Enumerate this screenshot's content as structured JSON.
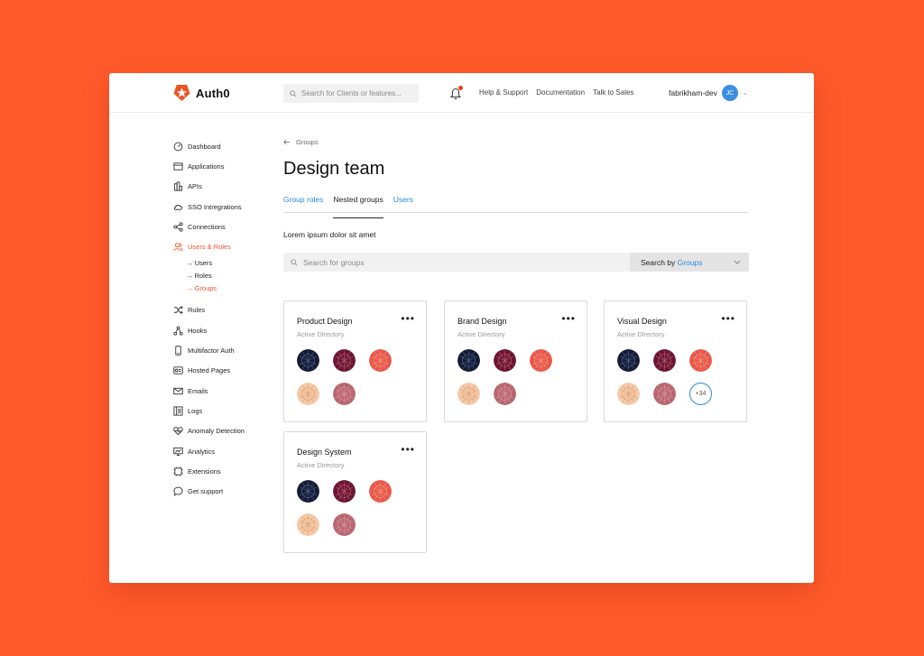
{
  "topbar": {
    "logo_text": "Auth0",
    "search_placeholder": "Search for Clients or features...",
    "links": [
      "Help & Support",
      "Documentation",
      "Talk to Sales"
    ],
    "tenant": "fabrikham-dev",
    "avatar_initials": "JC"
  },
  "sidebar": {
    "items": [
      {
        "label": "Dashboard",
        "icon": "dashboard-icon"
      },
      {
        "label": "Applications",
        "icon": "applications-icon"
      },
      {
        "label": "APIs",
        "icon": "apis-icon"
      },
      {
        "label": "SSO Intregrations",
        "icon": "cloud-icon"
      },
      {
        "label": "Connections",
        "icon": "connections-icon"
      },
      {
        "label": "Users & Roles",
        "icon": "users-icon",
        "active": true
      },
      {
        "label": "Rules",
        "icon": "rules-icon"
      },
      {
        "label": "Hooks",
        "icon": "hooks-icon"
      },
      {
        "label": "Multifactor Auth",
        "icon": "phone-icon"
      },
      {
        "label": "Hosted Pages",
        "icon": "hosted-pages-icon"
      },
      {
        "label": "Emails",
        "icon": "email-icon"
      },
      {
        "label": "Logs",
        "icon": "logs-icon"
      },
      {
        "label": "Anomaly Detection",
        "icon": "heart-icon"
      },
      {
        "label": "Analytics",
        "icon": "analytics-icon"
      },
      {
        "label": "Extensions",
        "icon": "extensions-icon"
      },
      {
        "label": "Get support",
        "icon": "chat-icon"
      }
    ],
    "subitems": [
      "→ Users",
      "→ Roles",
      "→ Groups"
    ]
  },
  "main": {
    "breadcrumb": "Groups",
    "title": "Design team",
    "tabs": [
      "Group roles",
      "Nested groups",
      "Users"
    ],
    "description": "Lorem ipsum dolor sit amet",
    "search_placeholder": "Search for groups",
    "search_by_prefix": "Search by",
    "search_by_value": "Groups"
  },
  "cards": [
    {
      "title": "Product Design",
      "subtitle": "Active Directory",
      "more": "•••"
    },
    {
      "title": "Brand Design",
      "subtitle": "Active Directory",
      "more": "•••"
    },
    {
      "title": "Visual Design",
      "subtitle": "Active Directory",
      "more": "•••",
      "extra": "+34"
    },
    {
      "title": "Design System",
      "subtitle": "Active Directory",
      "more": "•••"
    }
  ],
  "colors": {
    "background": "#ff5a2b",
    "accent": "#e8552b",
    "link": "#2b8bd6",
    "avatar_navy": "#141c33",
    "avatar_maroon": "#6b1530",
    "avatar_coral": "#e8584a",
    "avatar_peach": "#f5c9a6",
    "avatar_rose": "#b86670"
  }
}
